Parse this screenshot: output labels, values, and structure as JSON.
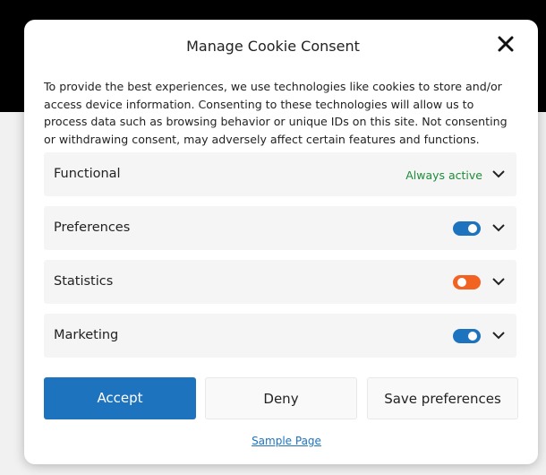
{
  "modal": {
    "title": "Manage Cookie Consent",
    "description": "To provide the best experiences, we use technologies like cookies to store and/or access device information. Consenting to these technologies will allow us to process data such as browsing behavior or unique IDs on this site. Not consenting or withdrawing consent, may adversely affect certain features and functions."
  },
  "close_icon": "close-icon",
  "categories": [
    {
      "label": "Functional",
      "status": "Always active"
    },
    {
      "label": "Preferences",
      "toggle_on": true,
      "toggle_color": "#1e73be"
    },
    {
      "label": "Statistics",
      "toggle_on": false,
      "toggle_color": "#f26322"
    },
    {
      "label": "Marketing",
      "toggle_on": true,
      "toggle_color": "#1e73be"
    }
  ],
  "buttons": {
    "accept": "Accept",
    "deny": "Deny",
    "save": "Save preferences"
  },
  "footer": {
    "link": "Sample Page"
  },
  "colors": {
    "accent": "#1e73be",
    "always_active": "#1e8c3a",
    "statistics_toggle": "#f26322"
  }
}
